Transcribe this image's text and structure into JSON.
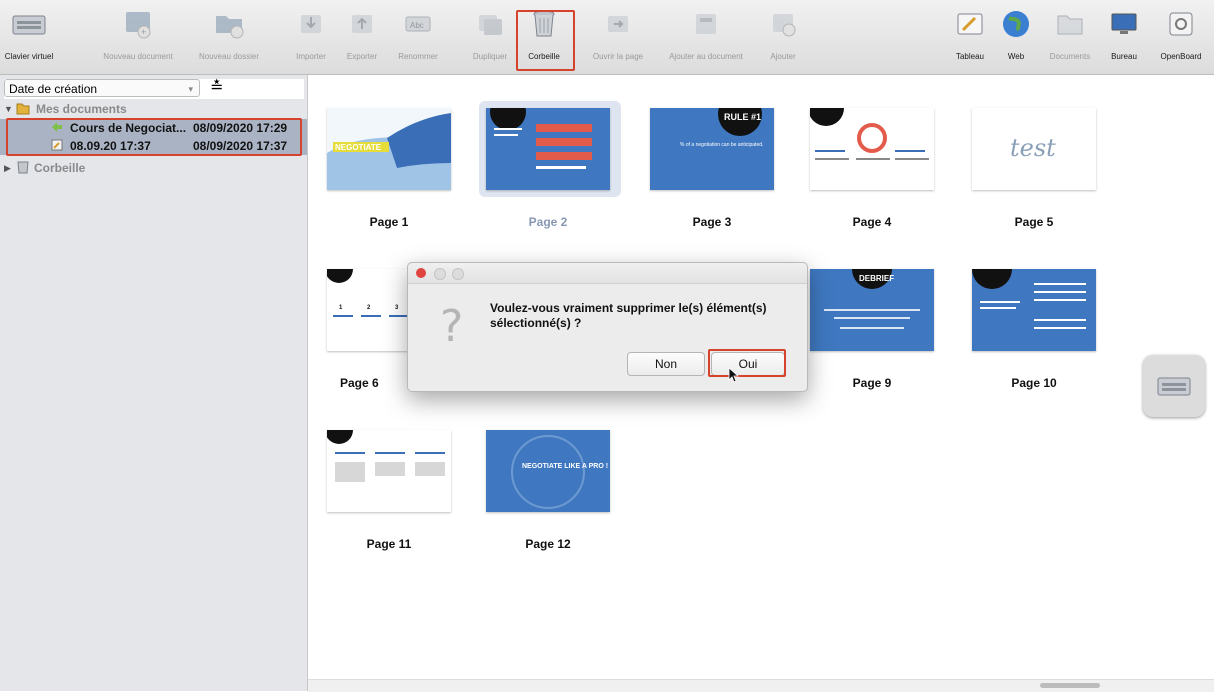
{
  "toolbar": {
    "items": [
      {
        "label": "Clavier virtuel",
        "icon": "keyboard-icon",
        "enabled": true
      },
      {
        "label": "Nouveau document",
        "icon": "new-document-icon",
        "enabled": false
      },
      {
        "label": "Nouveau dossier",
        "icon": "new-folder-icon",
        "enabled": false
      },
      {
        "label": "Importer",
        "icon": "import-icon",
        "enabled": false
      },
      {
        "label": "Exporter",
        "icon": "export-icon",
        "enabled": false
      },
      {
        "label": "Renommer",
        "icon": "rename-icon",
        "enabled": false
      },
      {
        "label": "Dupliquer",
        "icon": "duplicate-icon",
        "enabled": false
      },
      {
        "label": "Corbeille",
        "icon": "trash-icon",
        "enabled": true
      },
      {
        "label": "Ouvrir la page",
        "icon": "open-page-icon",
        "enabled": false
      },
      {
        "label": "Ajouter au document",
        "icon": "add-to-document-icon",
        "enabled": false
      },
      {
        "label": "Ajouter",
        "icon": "add-icon",
        "enabled": false
      },
      {
        "label": "Tableau",
        "icon": "board-icon",
        "enabled": true
      },
      {
        "label": "Web",
        "icon": "globe-icon",
        "enabled": true
      },
      {
        "label": "Documents",
        "icon": "documents-icon",
        "enabled": false
      },
      {
        "label": "Bureau",
        "icon": "desktop-icon",
        "enabled": true
      },
      {
        "label": "OpenBoard",
        "icon": "openboard-icon",
        "enabled": true
      }
    ]
  },
  "sidebar": {
    "sort_label": "Date de création",
    "tree": {
      "my_documents": "Mes documents",
      "docs": [
        {
          "name": "Cours de Negociat...",
          "date": "08/09/2020 17:29"
        },
        {
          "name": "08.09.20 17:37",
          "date": "08/09/2020 17:37"
        }
      ],
      "trash": "Corbeille"
    }
  },
  "pages": [
    {
      "label": "Page 1"
    },
    {
      "label": "Page 2"
    },
    {
      "label": "Page 3"
    },
    {
      "label": "Page 4"
    },
    {
      "label": "Page 5"
    },
    {
      "label": "Page 6"
    },
    {
      "label": "Page 9"
    },
    {
      "label": "Page 10"
    },
    {
      "label": "Page 11"
    },
    {
      "label": "Page 12"
    }
  ],
  "thumb_text": {
    "p1": "NEGOTIATE",
    "p3_title": "RULE #1",
    "p3_body": "% of a negotiation can be anticipated.",
    "p5": "test",
    "p9": "DEBRIEF",
    "p12": "NEGOTIATE LIKE A PRO !",
    "p6_nums": [
      "1",
      "2",
      "3"
    ]
  },
  "dialog": {
    "message": "Voulez-vous vraiment supprimer le(s) élément(s) sélectionné(s) ?",
    "no_label": "Non",
    "yes_label": "Oui"
  },
  "colors": {
    "highlight": "#d6432c",
    "slide_blue": "#3f78c0",
    "selection": "#aab3c4"
  }
}
